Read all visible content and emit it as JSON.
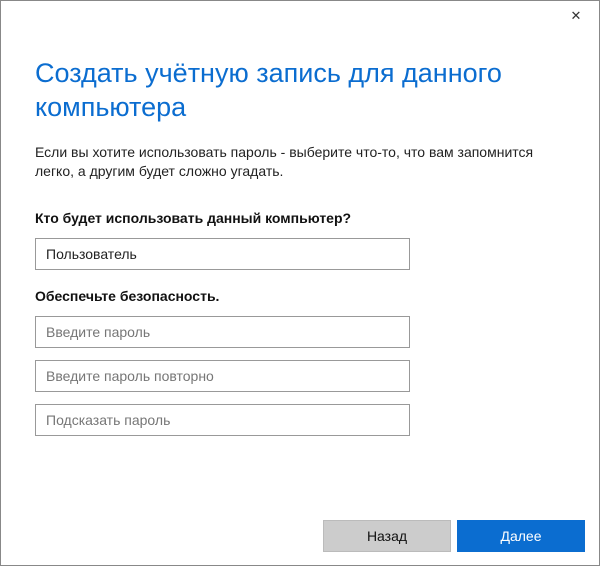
{
  "titlebar": {
    "close": "✕"
  },
  "heading": "Создать учётную запись для данного компьютера",
  "description": "Если вы хотите использовать пароль - выберите что-то, что вам запомнится легко, а другим будет сложно угадать.",
  "user_section": {
    "label": "Кто будет использовать данный компьютер?",
    "username_value": "Пользователь"
  },
  "security_section": {
    "label": "Обеспечьте безопасность.",
    "password_placeholder": "Введите пароль",
    "password_confirm_placeholder": "Введите пароль повторно",
    "hint_placeholder": "Подсказать пароль"
  },
  "footer": {
    "back_label": "Назад",
    "next_label": "Далее"
  }
}
